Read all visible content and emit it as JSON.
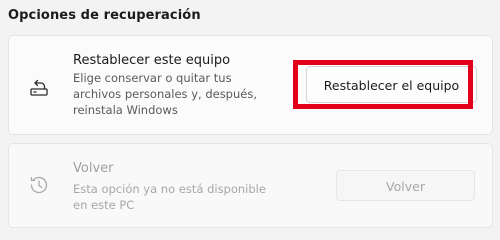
{
  "section_title": "Opciones de recuperación",
  "reset": {
    "icon": "reset-pc-icon",
    "title": "Restablecer este equipo",
    "description": "Elige conservar o quitar tus archivos personales y, después, reinstala Windows",
    "button_label": "Restablecer el equipo"
  },
  "go_back": {
    "icon": "history-clock-icon",
    "title": "Volver",
    "description": "Esta opción ya no está disponible en este PC",
    "button_label": "Volver",
    "disabled": true
  },
  "highlight_color": "#e3001b"
}
